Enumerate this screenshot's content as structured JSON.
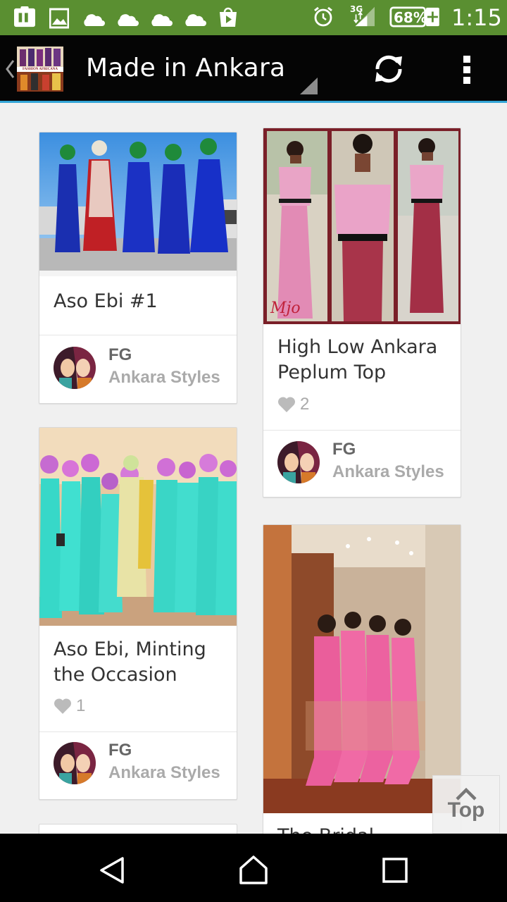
{
  "status_bar": {
    "network_type": "3G",
    "battery": "68%",
    "time": "1:15"
  },
  "action_bar": {
    "title": "Made in Ankara",
    "logo_text": "FASHION AFRICANA"
  },
  "cards": [
    {
      "title": "Aso Ebi #1",
      "likes": "",
      "user": "FG",
      "board": "Ankara Styles"
    },
    {
      "title": "High Low Ankara Peplum Top",
      "likes": "2",
      "user": "FG",
      "board": "Ankara Styles"
    },
    {
      "title": "Aso Ebi, Minting the Occasion",
      "likes": "1",
      "user": "FG",
      "board": "Ankara Styles"
    },
    {
      "title": "The Bridal",
      "likes": "",
      "user": "",
      "board": ""
    }
  ],
  "top_button": {
    "label": "Top"
  },
  "colors": {
    "status_bar": "#5a8f31",
    "action_bar": "#050505",
    "accent_line": "#33a4d6",
    "background": "#f0f0f0"
  },
  "icons": {
    "status_left": [
      "app-icon",
      "image-icon",
      "cloud-icon",
      "cloud-icon",
      "cloud-icon",
      "cloud-icon",
      "play-store-icon"
    ],
    "status_right": [
      "alarm-icon",
      "signal-icon",
      "battery-icon"
    ],
    "action_bar": [
      "back-chevron-icon",
      "refresh-icon",
      "overflow-menu-icon"
    ],
    "nav_bar": [
      "back-icon",
      "home-icon",
      "recents-icon"
    ]
  }
}
